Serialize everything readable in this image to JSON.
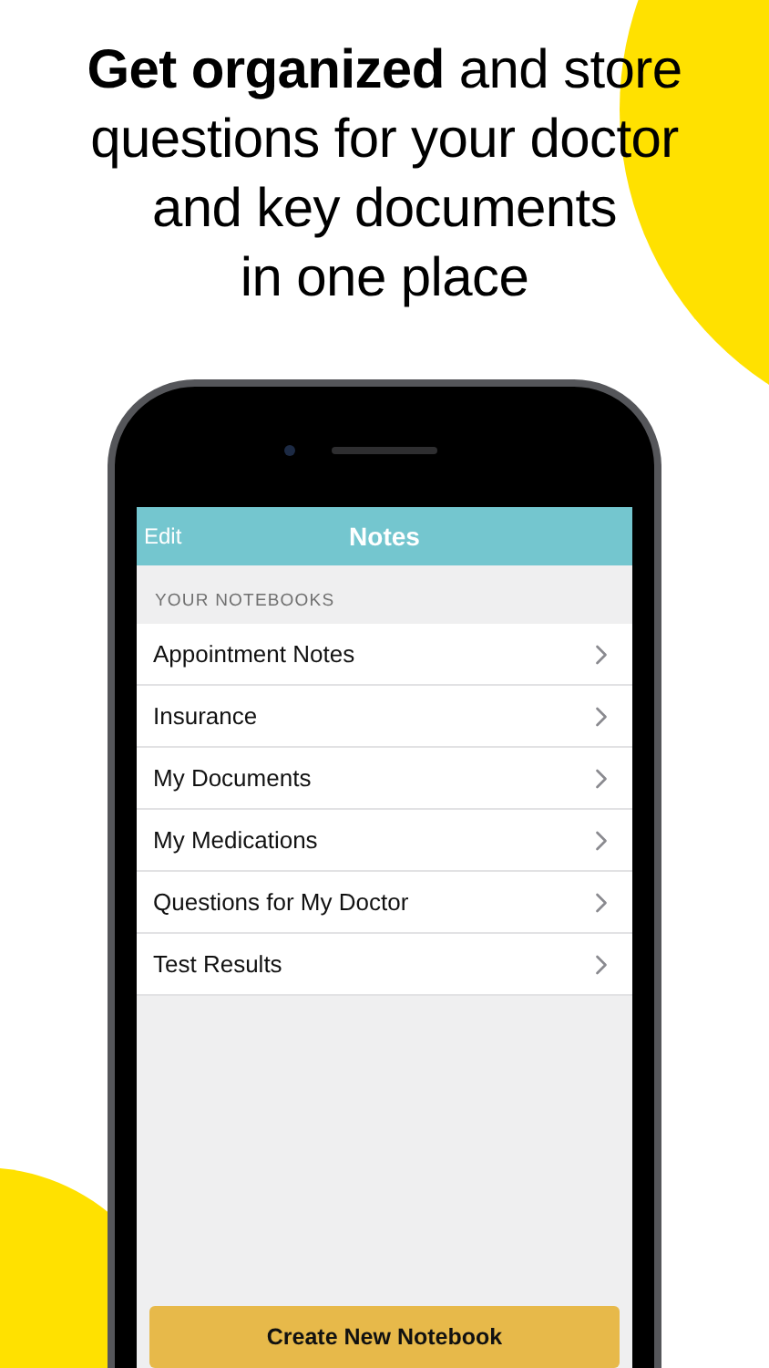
{
  "headline": "**Get organized** and store\nquestions for your doctor\nand key documents\nin one place",
  "nav_bar": {
    "left_button": "Edit",
    "title": "Notes"
  },
  "section_header": "YOUR NOTEBOOKS",
  "notebooks": [
    {
      "label": "Appointment Notes"
    },
    {
      "label": "Insurance"
    },
    {
      "label": "My Documents"
    },
    {
      "label": "My Medications"
    },
    {
      "label": "Questions for My Doctor"
    },
    {
      "label": "Test Results"
    }
  ],
  "primary_button": "Create New Notebook"
}
